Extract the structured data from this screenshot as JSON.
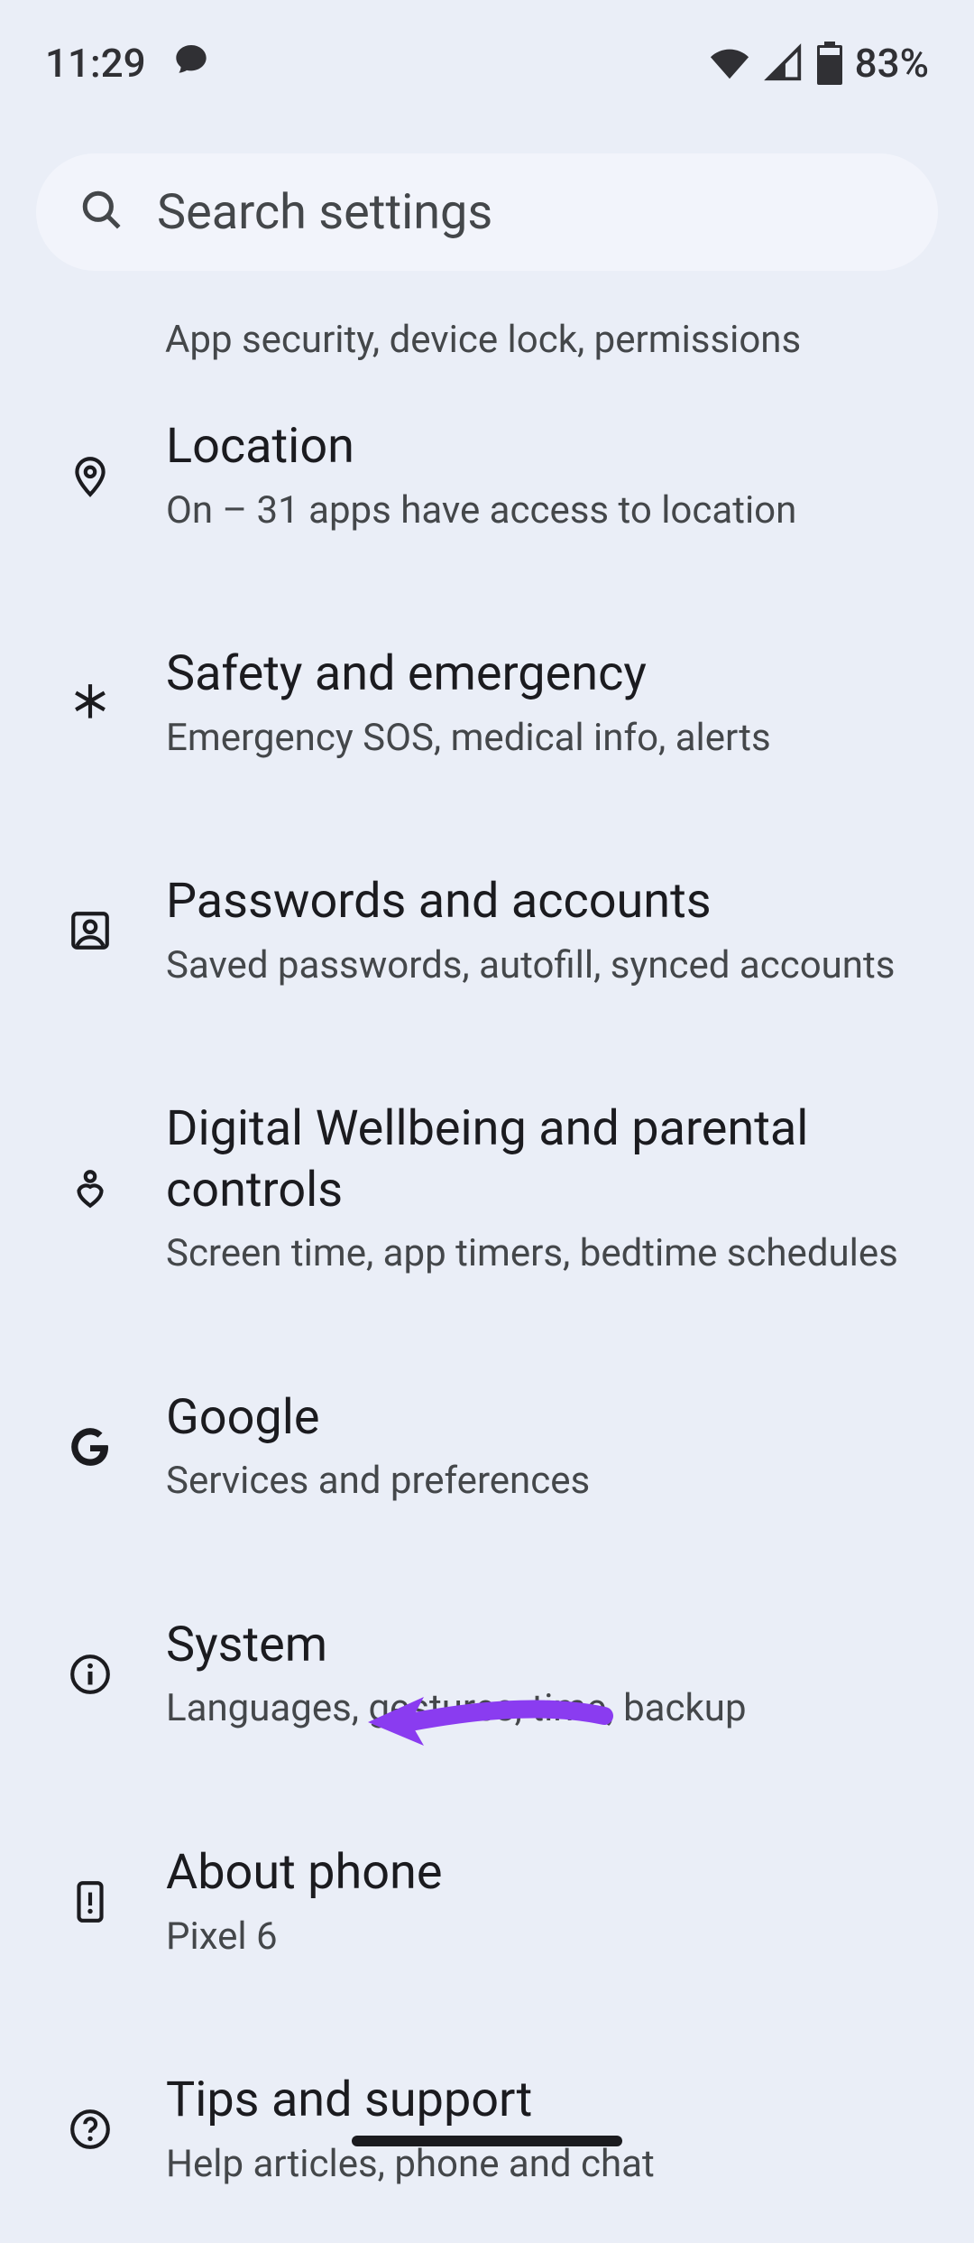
{
  "status": {
    "time": "11:29",
    "battery": "83%"
  },
  "search": {
    "placeholder": "Search settings"
  },
  "partial_item": {
    "subtitle": "App security, device lock, permissions"
  },
  "items": [
    {
      "icon": "location-pin-icon",
      "title": "Location",
      "subtitle": "On – 31 apps have access to location"
    },
    {
      "icon": "medical-asterisk-icon",
      "title": "Safety and emergency",
      "subtitle": "Emergency SOS, medical info, alerts"
    },
    {
      "icon": "account-box-icon",
      "title": "Passwords and accounts",
      "subtitle": "Saved passwords, autofill, synced accounts"
    },
    {
      "icon": "wellbeing-icon",
      "title": "Digital Wellbeing and parental controls",
      "subtitle": "Screen time, app timers, bedtime schedules"
    },
    {
      "icon": "google-g-icon",
      "title": "Google",
      "subtitle": "Services and preferences"
    },
    {
      "icon": "info-icon",
      "title": "System",
      "subtitle": "Languages, gestures, time, backup"
    },
    {
      "icon": "phone-device-icon",
      "title": "About phone",
      "subtitle": "Pixel 6"
    },
    {
      "icon": "help-icon",
      "title": "Tips and support",
      "subtitle": "Help articles, phone and chat"
    }
  ],
  "annotation": {
    "target": "System",
    "color": "#8a3cf0"
  }
}
